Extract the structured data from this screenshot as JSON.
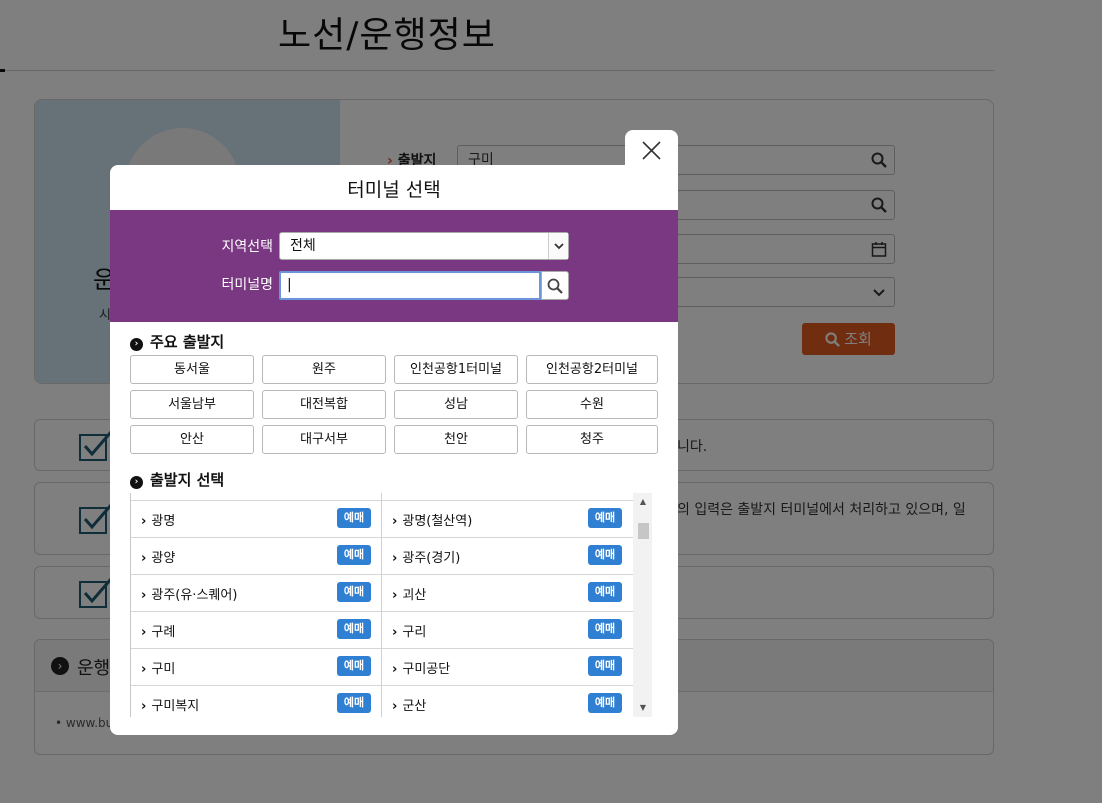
{
  "page": {
    "title": "노선/운행정보",
    "side_title": "운",
    "side_sub": "시"
  },
  "form": {
    "departure_label": "출발지",
    "departure_value": "구미",
    "query_button": "조회"
  },
  "info": {
    "line1_tail": "니다.",
    "line2_tail": "의 입력은 출발지 터미널에서 처리하고 있으며, 일"
  },
  "ops": {
    "title": "운행",
    "link": "• www.bu"
  },
  "modal": {
    "title": "터미널 선택",
    "region_label": "지역선택",
    "region_value": "전체",
    "terminal_label": "터미널명",
    "terminal_value": "|",
    "major_section": "주요 출발지",
    "major": [
      "동서울",
      "원주",
      "인천공항1터미널",
      "인천공항2터미널",
      "서울남부",
      "대전복합",
      "성남",
      "수원",
      "안산",
      "대구서부",
      "천안",
      "청주"
    ],
    "list_section": "출발지 선택",
    "badge_label": "예매",
    "list": [
      {
        "left": "광명",
        "right": "광명(철산역)"
      },
      {
        "left": "광양",
        "right": "광주(경기)"
      },
      {
        "left": "광주(유·스퀘어)",
        "right": "괴산"
      },
      {
        "left": "구례",
        "right": "구리"
      },
      {
        "left": "구미",
        "right": "구미공단"
      },
      {
        "left": "구미복지",
        "right": "군산"
      }
    ]
  },
  "colors": {
    "filter_bg": "#7a3882",
    "badge": "#2f7fd3",
    "query_button": "#e35b1e"
  },
  "icons": [
    "close-icon",
    "search-icon",
    "calendar-icon",
    "check-icon",
    "chevron-right-icon",
    "chevron-down-icon"
  ]
}
